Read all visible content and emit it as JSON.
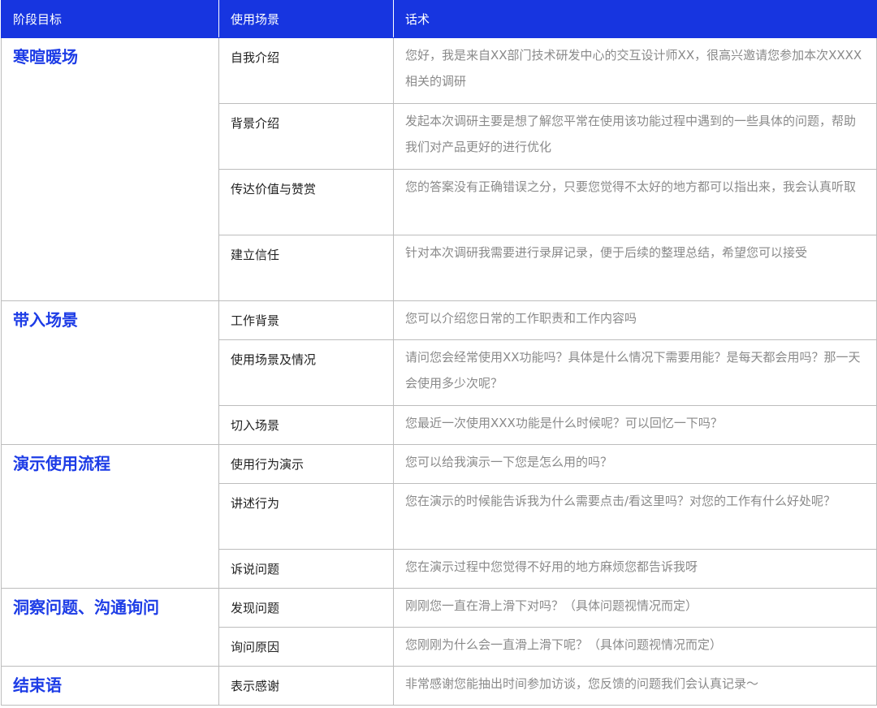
{
  "headers": [
    "阶段目标",
    "使用场景",
    "话术"
  ],
  "stages": [
    {
      "title": "寒暄暖场",
      "rows": [
        {
          "scene": "自我介绍",
          "script": "您好，我是来自XX部门技术研发中心的交互设计师XX，很高兴邀请您参加本次XXXX相关的调研"
        },
        {
          "scene": "背景介绍",
          "script": "发起本次调研主要是想了解您平常在使用该功能过程中遇到的一些具体的问题，帮助我们对产品更好的进行优化"
        },
        {
          "scene": "传达价值与赞赏",
          "script": "您的答案没有正确错误之分，只要您觉得不太好的地方都可以指出来，我会认真听取"
        },
        {
          "scene": "建立信任",
          "script": "针对本次调研我需要进行录屏记录，便于后续的整理总结，希望您可以接受"
        }
      ]
    },
    {
      "title": "带入场景",
      "rows": [
        {
          "scene": "工作背景",
          "script": "您可以介绍您日常的工作职责和工作内容吗"
        },
        {
          "scene": "使用场景及情况",
          "script": "请问您会经常使用XX功能吗？具体是什么情况下需要用能？是每天都会用吗？那一天会使用多少次呢？"
        },
        {
          "scene": "切入场景",
          "script": "您最近一次使用XXX功能是什么时候呢？可以回忆一下吗？"
        }
      ]
    },
    {
      "title": "演示使用流程",
      "rows": [
        {
          "scene": "使用行为演示",
          "script": "您可以给我演示一下您是怎么用的吗？"
        },
        {
          "scene": "讲述行为",
          "script": "您在演示的时候能告诉我为什么需要点击/看这里吗？对您的工作有什么好处呢？"
        },
        {
          "scene": "诉说问题",
          "script": "您在演示过程中您觉得不好用的地方麻烦您都告诉我呀"
        }
      ]
    },
    {
      "title": "洞察问题、沟通询问",
      "rows": [
        {
          "scene": "发现问题",
          "script": "刚刚您一直在滑上滑下对吗？（具体问题视情况而定）"
        },
        {
          "scene": "询问原因",
          "script": "您刚刚为什么会一直滑上滑下呢？（具体问题视情况而定）"
        }
      ]
    },
    {
      "title": "结束语",
      "rows": [
        {
          "scene": "表示感谢",
          "script": "非常感谢您能抽出时间参加访谈，您反馈的问题我们会认真记录～"
        }
      ]
    }
  ]
}
